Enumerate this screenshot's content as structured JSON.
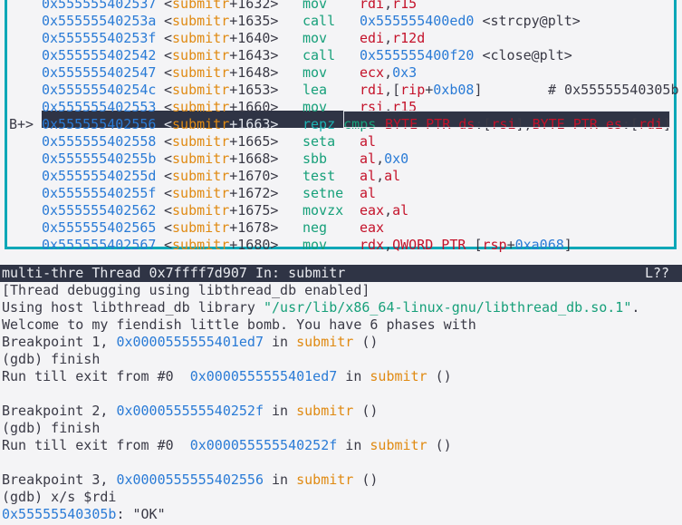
{
  "disasm": {
    "partial_top": {
      "marker": "",
      "address": "0x555555402537",
      "func": "submitr",
      "offset": "+1632",
      "mnemonic": "mov",
      "operands": "rdi,r15"
    },
    "lines": [
      {
        "marker": "",
        "address": "0x55555540253a",
        "func": "submitr",
        "offset": "+1635",
        "mnemonic": "call",
        "operands": "0x555555400ed0 <strcpy@plt>",
        "comment": ""
      },
      {
        "marker": "",
        "address": "0x55555540253f",
        "func": "submitr",
        "offset": "+1640",
        "mnemonic": "mov",
        "operands": "edi,r12d",
        "comment": ""
      },
      {
        "marker": "",
        "address": "0x555555402542",
        "func": "submitr",
        "offset": "+1643",
        "mnemonic": "call",
        "operands": "0x555555400f20 <close@plt>",
        "comment": ""
      },
      {
        "marker": "",
        "address": "0x555555402547",
        "func": "submitr",
        "offset": "+1648",
        "mnemonic": "mov",
        "operands": "ecx,0x3",
        "comment": ""
      },
      {
        "marker": "",
        "address": "0x55555540254c",
        "func": "submitr",
        "offset": "+1653",
        "mnemonic": "lea",
        "operands": "rdi,[rip+0xb08]",
        "comment": "# 0x55555540305b"
      },
      {
        "marker": "",
        "address": "0x555555402553",
        "func": "submitr",
        "offset": "+1660",
        "mnemonic": "mov",
        "operands": "rsi,r15",
        "comment": ""
      },
      {
        "marker": "B+>",
        "address": "0x555555402556",
        "func": "submitr",
        "offset": "+1663",
        "mnemonic": "repz cmps",
        "operands": "BYTE PTR ds:[rsi],BYTE PTR es:[rdi]",
        "comment": ""
      },
      {
        "marker": "",
        "address": "0x555555402558",
        "func": "submitr",
        "offset": "+1665",
        "mnemonic": "seta",
        "operands": "al",
        "comment": ""
      },
      {
        "marker": "",
        "address": "0x55555540255b",
        "func": "submitr",
        "offset": "+1668",
        "mnemonic": "sbb",
        "operands": "al,0x0",
        "comment": ""
      },
      {
        "marker": "",
        "address": "0x55555540255d",
        "func": "submitr",
        "offset": "+1670",
        "mnemonic": "test",
        "operands": "al,al",
        "comment": ""
      },
      {
        "marker": "",
        "address": "0x55555540255f",
        "func": "submitr",
        "offset": "+1672",
        "mnemonic": "setne",
        "operands": "al",
        "comment": ""
      },
      {
        "marker": "",
        "address": "0x555555402562",
        "func": "submitr",
        "offset": "+1675",
        "mnemonic": "movzx",
        "operands": "eax,al",
        "comment": ""
      },
      {
        "marker": "",
        "address": "0x555555402565",
        "func": "submitr",
        "offset": "+1678",
        "mnemonic": "neg",
        "operands": "eax",
        "comment": ""
      },
      {
        "marker": "",
        "address": "0x555555402567",
        "func": "submitr",
        "offset": "+1680",
        "mnemonic": "mov",
        "operands": "rdx,QWORD PTR [rsp+0xa068]",
        "comment": ""
      }
    ]
  },
  "status": {
    "left": "multi-thre Thread 0x7ffff7d907 In: submitr",
    "right": "L??"
  },
  "console": {
    "l1": "[Thread debugging using libthread_db enabled]",
    "l2a": "Using host libthread_db library ",
    "l2b": "\"/usr/lib/x86_64-linux-gnu/libthread_db.so.1\"",
    "l2c": ".",
    "l3": "Welcome to my fiendish little bomb. You have 6 phases with",
    "bp1_a": "Breakpoint 1, ",
    "bp1_addr": "0x0000555555401ed7",
    "bp1_in": " in ",
    "bp1_fn": "submitr",
    "bp1_end": " ()",
    "cmd1": "(gdb) finish",
    "run1_a": "Run till exit from #0  ",
    "run1_addr": "0x0000555555401ed7",
    "run1_in": " in ",
    "run1_fn": "submitr",
    "run1_end": " ()",
    "bp2_a": "Breakpoint 2, ",
    "bp2_addr": "0x000055555540252f",
    "bp2_in": " in ",
    "bp2_fn": "submitr",
    "bp2_end": " ()",
    "cmd2": "(gdb) finish",
    "run2_a": "Run till exit from #0  ",
    "run2_addr": "0x000055555540252f",
    "run2_in": " in ",
    "run2_fn": "submitr",
    "run2_end": " ()",
    "bp3_a": "Breakpoint 3, ",
    "bp3_addr": "0x0000555555402556",
    "bp3_in": " in ",
    "bp3_fn": "submitr",
    "bp3_end": " ()",
    "cmd3": "(gdb) x/s $rdi",
    "res_addr": "0x55555540305b",
    "res_sep": ": ",
    "res_val": "\"OK\""
  }
}
